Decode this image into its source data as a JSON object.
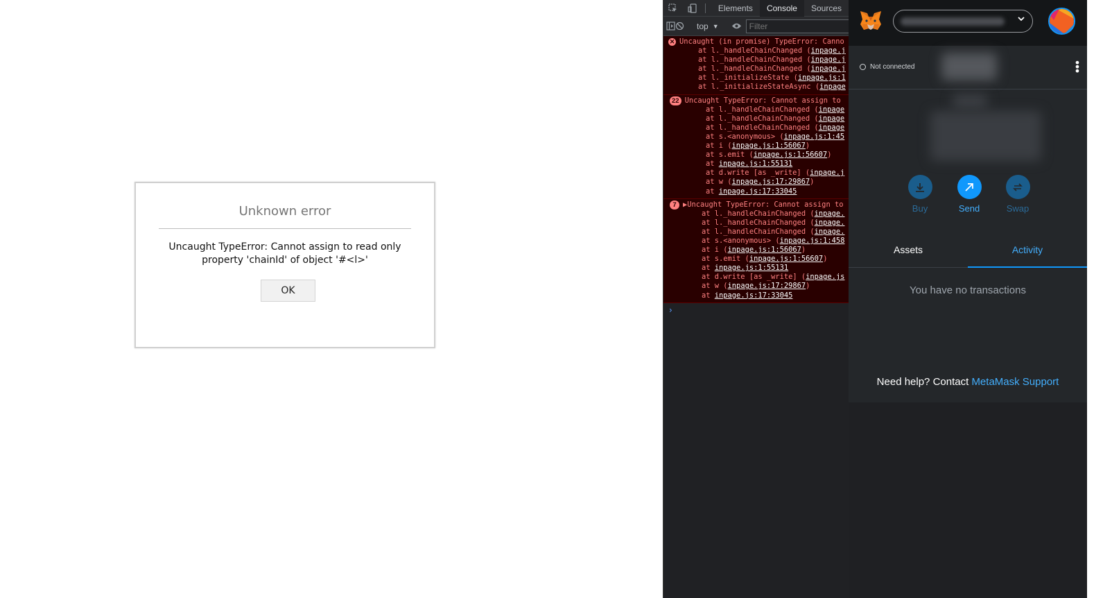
{
  "dialog": {
    "title": "Unknown error",
    "message_line1": "Uncaught TypeError: Cannot assign to read only",
    "message_line2": "property 'chainId' of object '#<l>'",
    "ok_label": "OK"
  },
  "devtools": {
    "tabs": [
      "Elements",
      "Console",
      "Sources"
    ],
    "active_tab": "Console",
    "context": "top",
    "filter_placeholder": "Filter",
    "entries": [
      {
        "badge": "x",
        "head": "Uncaught (in promise) TypeError: Canno",
        "frames": [
          {
            "at": "at l._handleChainChanged (",
            "link": "inpage.j"
          },
          {
            "at": "at l._handleChainChanged (",
            "link": "inpage.j"
          },
          {
            "at": "at l._handleChainChanged (",
            "link": "inpage.j"
          },
          {
            "at": "at l._initializeState (",
            "link": "inpage.js:1"
          },
          {
            "at": "at l._initializeStateAsync (",
            "link": "inpage"
          }
        ]
      },
      {
        "badge": "22",
        "head": "Uncaught TypeError: Cannot assign to",
        "frames": [
          {
            "at": "at l._handleChainChanged (",
            "link": "inpage"
          },
          {
            "at": "at l._handleChainChanged (",
            "link": "inpage"
          },
          {
            "at": "at l._handleChainChanged (",
            "link": "inpage"
          },
          {
            "at": "at s.<anonymous> (",
            "link": "inpage.js:1:45"
          },
          {
            "at": "at i (",
            "link": "inpage.js:1:56067",
            "tail": ")"
          },
          {
            "at": "at s.emit (",
            "link": "inpage.js:1:56607",
            "tail": ")"
          },
          {
            "at": "at ",
            "link": "inpage.js:1:55131"
          },
          {
            "at": "at d.write [as _write] (",
            "link": "inpage.j"
          },
          {
            "at": "at w (",
            "link": "inpage.js:17:29867",
            "tail": ")"
          },
          {
            "at": "at ",
            "link": "inpage.js:17:33045"
          }
        ]
      },
      {
        "badge": "7",
        "head": "▶Uncaught TypeError: Cannot assign to",
        "frames": [
          {
            "at": "at l._handleChainChanged (",
            "link": "inpage."
          },
          {
            "at": "at l._handleChainChanged (",
            "link": "inpage."
          },
          {
            "at": "at l._handleChainChanged (",
            "link": "inpage."
          },
          {
            "at": "at s.<anonymous> (",
            "link": "inpage.js:1:458"
          },
          {
            "at": "at i (",
            "link": "inpage.js:1:56067",
            "tail": ")"
          },
          {
            "at": "at s.emit (",
            "link": "inpage.js:1:56607",
            "tail": ")"
          },
          {
            "at": "at ",
            "link": "inpage.js:1:55131"
          },
          {
            "at": "at d.write [as _write] (",
            "link": "inpage.js"
          },
          {
            "at": "at w (",
            "link": "inpage.js:17:29867",
            "tail": ")"
          },
          {
            "at": "at ",
            "link": "inpage.js:17:33045"
          }
        ]
      }
    ],
    "prompt": "›"
  },
  "metamask": {
    "connection_status": "Not connected",
    "actions": [
      {
        "label": "Buy",
        "icon": "download-icon",
        "state": "dim"
      },
      {
        "label": "Send",
        "icon": "arrow-up-right-icon",
        "state": "on"
      },
      {
        "label": "Swap",
        "icon": "swap-icon",
        "state": "dim"
      }
    ],
    "tabs": [
      "Assets",
      "Activity"
    ],
    "active_tab": "Activity",
    "empty_text": "You have no transactions",
    "help_text": "Need help? Contact ",
    "help_link": "MetaMask Support",
    "colors": {
      "accent": "#1098fc",
      "background": "#24272a",
      "header": "#141618"
    }
  }
}
